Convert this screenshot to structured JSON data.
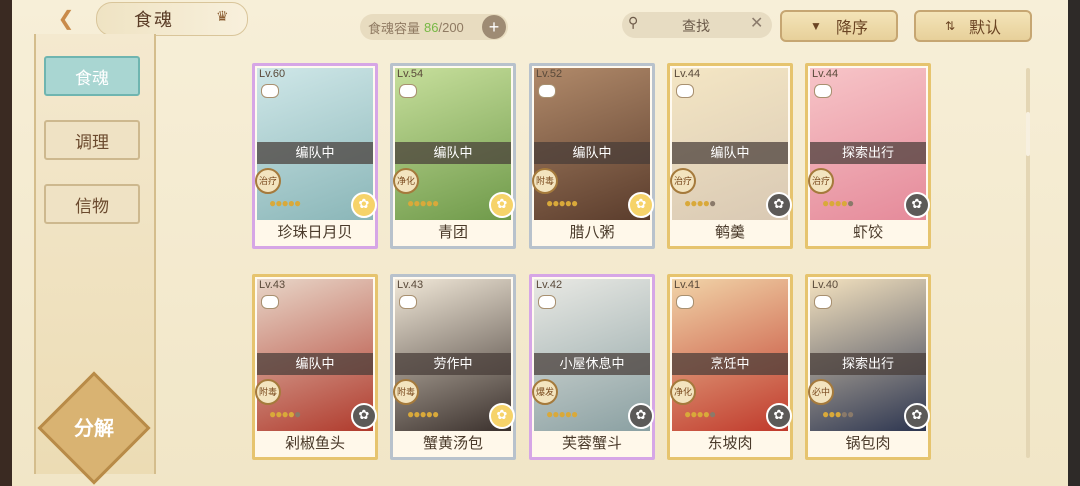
{
  "header": {
    "title": "食魂",
    "capacity_label": "食魂容量",
    "capacity_current": "86",
    "capacity_total": "/200",
    "plus": "+",
    "search_placeholder": "查找",
    "clear": "✕",
    "sort_order": "降序",
    "sort_mode": "默认"
  },
  "sidebar": {
    "items": [
      {
        "label": "食魂",
        "active": true
      },
      {
        "label": "调理",
        "active": false
      },
      {
        "label": "信物",
        "active": false
      }
    ],
    "decompose": "分解"
  },
  "cards": [
    {
      "lv": "Lv.60",
      "status": "编队中",
      "tag": "治疗",
      "name": "珍珠日月贝",
      "stars": 5,
      "frame": "rainbow",
      "flower": "gold",
      "colors": [
        "#cfe7e8",
        "#8ab6b8"
      ]
    },
    {
      "lv": "Lv.54",
      "status": "编队中",
      "tag": "净化",
      "name": "青团",
      "stars": 5,
      "frame": "silver",
      "flower": "gold",
      "colors": [
        "#c7df9c",
        "#6f9a4a"
      ]
    },
    {
      "lv": "Lv.52",
      "status": "编队中",
      "tag": "附毒",
      "name": "腊八粥",
      "stars": 5,
      "frame": "silver",
      "flower": "gold",
      "colors": [
        "#b18a6a",
        "#5a3c2c"
      ]
    },
    {
      "lv": "Lv.44",
      "status": "编队中",
      "tag": "治疗",
      "name": "鹌羹",
      "stars": 4,
      "frame": "gold",
      "flower": "dark",
      "colors": [
        "#f4e6c4",
        "#d9c9b4"
      ]
    },
    {
      "lv": "Lv.44",
      "status": "探索出行",
      "tag": "治疗",
      "name": "虾饺",
      "stars": 4,
      "frame": "gold",
      "flower": "dark",
      "colors": [
        "#f7c5c8",
        "#e58a9a"
      ]
    },
    {
      "lv": "Lv.43",
      "status": "编队中",
      "tag": "附毒",
      "name": "剁椒鱼头",
      "stars": 4,
      "frame": "gold",
      "flower": "dark",
      "colors": [
        "#e8d6c8",
        "#b03a2c"
      ]
    },
    {
      "lv": "Lv.43",
      "status": "劳作中",
      "tag": "附毒",
      "name": "蟹黄汤包",
      "stars": 5,
      "frame": "silver",
      "flower": "gold",
      "colors": [
        "#f1e8d8",
        "#3a302c"
      ]
    },
    {
      "lv": "Lv.42",
      "status": "小屋休息中",
      "tag": "爆发",
      "name": "芙蓉蟹斗",
      "stars": 5,
      "frame": "rainbow",
      "flower": "dark",
      "colors": [
        "#e9e9e4",
        "#8aa0a2"
      ]
    },
    {
      "lv": "Lv.41",
      "status": "烹饪中",
      "tag": "净化",
      "name": "东坡肉",
      "stars": 4,
      "frame": "gold",
      "flower": "dark",
      "colors": [
        "#f1d4a8",
        "#c0392b"
      ]
    },
    {
      "lv": "Lv.40",
      "status": "探索出行",
      "tag": "必中",
      "name": "锅包肉",
      "stars": 3,
      "frame": "gold",
      "flower": "dark",
      "colors": [
        "#f4e2bf",
        "#2c3550"
      ]
    }
  ]
}
